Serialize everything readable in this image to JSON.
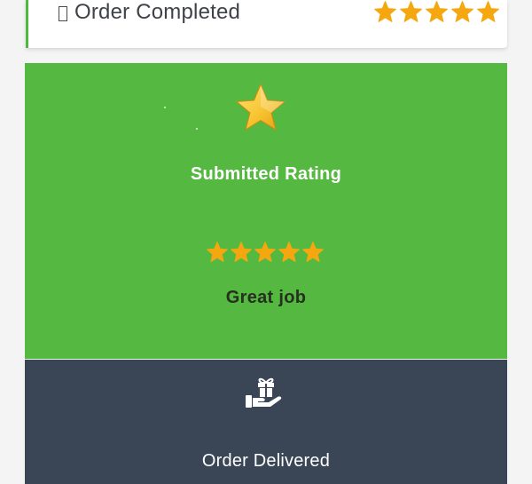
{
  "order": {
    "status_label": "Order Completed",
    "status_icon": "missing-glyph-icon",
    "rating_stars": 5
  },
  "rating": {
    "icon": "star-icon",
    "title": "Submitted Rating",
    "stars": 5,
    "comment": "Great job"
  },
  "delivery": {
    "icon": "gift-hand-icon",
    "label": "Order Delivered"
  },
  "colors": {
    "accent_green": "#55b840",
    "dark_panel": "#3a4555",
    "star_gold": "#f5a70f",
    "page_bg": "#f3f4f3"
  }
}
